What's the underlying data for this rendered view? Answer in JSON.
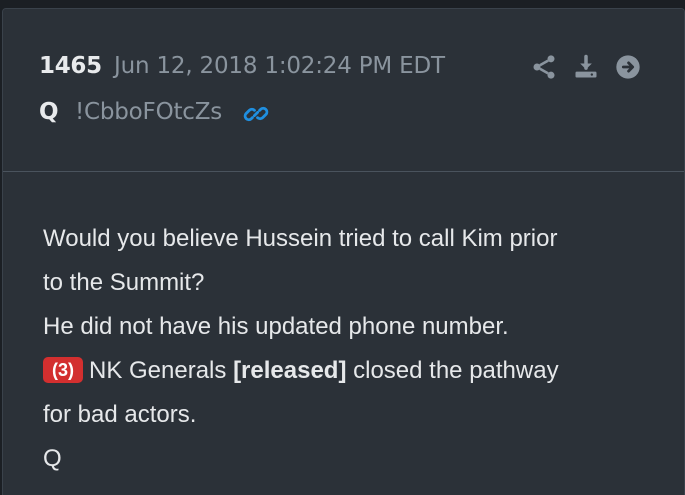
{
  "post": {
    "number": "1465",
    "timestamp": "Jun 12, 2018 1:02:24 PM EDT",
    "author": "Q",
    "tripcode": "!CbboFOtcZs",
    "icons": {
      "link": "link-icon",
      "share": "share-icon",
      "download": "download-icon",
      "next": "arrow-right-circle-icon"
    },
    "colors": {
      "background": "#1b1f24",
      "card": "#2b3138",
      "link": "#1f8fe0",
      "icon": "#8a949e",
      "badge": "#d32f2f"
    }
  },
  "message": {
    "line1": "Would you believe Hussein tried to call Kim prior",
    "line2": "to the Summit?",
    "line3": "He did not have his updated phone number.",
    "badge": "(3)",
    "line4_prefix": "NK Generals ",
    "line4_bold": "[released]",
    "line4_suffix": " closed the pathway",
    "line5": "for bad actors.",
    "signature": "Q"
  }
}
